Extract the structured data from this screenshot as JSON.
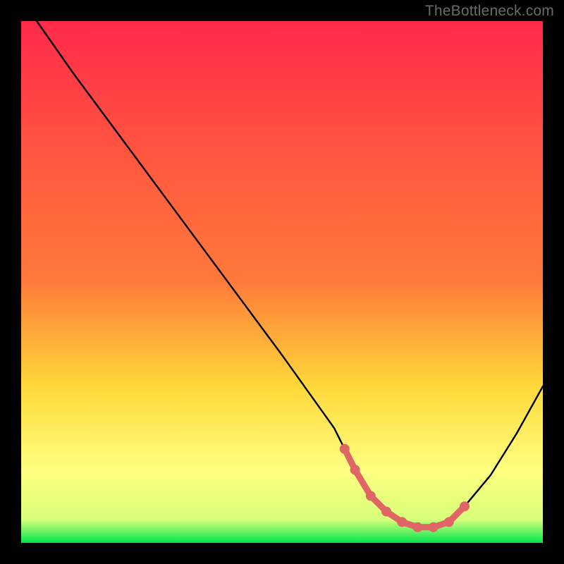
{
  "attribution": "TheBottleneck.com",
  "colors": {
    "background": "#000000",
    "gradient_top": "#ff2a4a",
    "gradient_mid_orange": "#ff7a3a",
    "gradient_mid_yellow": "#ffd83a",
    "gradient_light_yellow": "#ffff80",
    "gradient_bottom": "#00e64d",
    "curve": "#000000",
    "marker": "#e06666",
    "attribution_text": "#6a6a6a"
  },
  "chart_data": {
    "type": "line",
    "title": "",
    "xlabel": "",
    "ylabel": "",
    "xlim": [
      0,
      100
    ],
    "ylim": [
      0,
      100
    ],
    "series": [
      {
        "name": "bottleneck-curve",
        "x": [
          3,
          10,
          20,
          30,
          40,
          50,
          60,
          62,
          64,
          67,
          70,
          73,
          76,
          79,
          82,
          85,
          90,
          95,
          100
        ],
        "y": [
          100,
          90,
          76.5,
          63,
          49.5,
          36,
          22,
          18,
          14,
          9,
          6,
          4,
          3,
          3,
          4,
          7,
          13,
          21,
          30
        ]
      }
    ],
    "markers": {
      "name": "optimal-range",
      "x": [
        62,
        64,
        67,
        70,
        73,
        76,
        79,
        82,
        85
      ],
      "y": [
        18,
        14,
        9,
        6,
        4,
        3,
        3,
        4,
        7
      ]
    }
  }
}
